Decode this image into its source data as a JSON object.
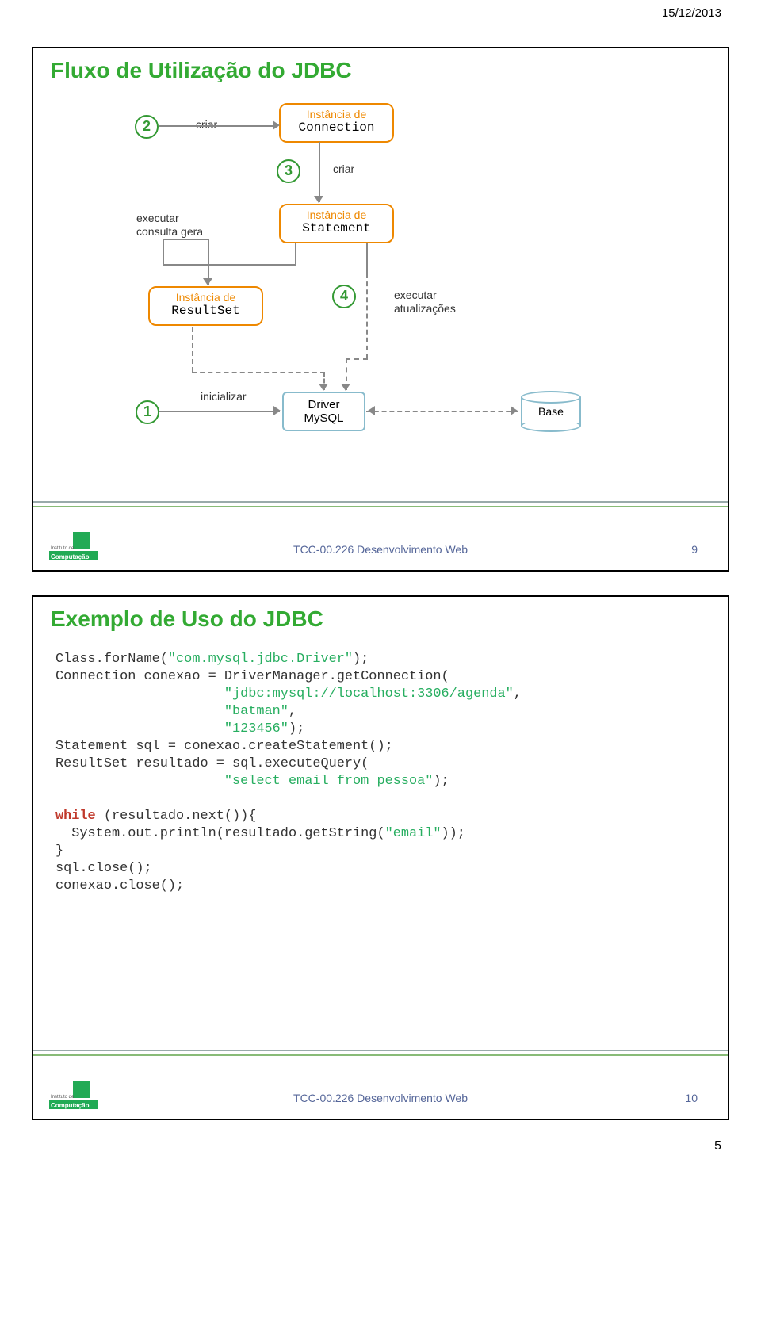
{
  "date": "15/12/2013",
  "slide1": {
    "title": "Fluxo de Utilização do JDBC",
    "labels": {
      "criar2": "criar",
      "criar3": "criar",
      "executar_consulta": "executar",
      "consulta_gera": "consulta gera",
      "executar_atualizacoes1": "executar",
      "executar_atualizacoes2": "atualizações",
      "inicializar": "inicializar"
    },
    "boxes": {
      "connection_lbl": "Instância de",
      "connection_name": "Connection",
      "statement_lbl": "Instância de",
      "statement_name": "Statement",
      "resultset_lbl": "Instância de",
      "resultset_name": "ResultSet",
      "driver_l1": "Driver",
      "driver_l2": "MySQL",
      "base": "Base"
    },
    "nums": {
      "n1": "1",
      "n2": "2",
      "n3": "3",
      "n4": "4"
    },
    "footer": {
      "text": "TCC-00.226 Desenvolvimento Web",
      "num": "9"
    }
  },
  "slide2": {
    "title": "Exemplo de Uso do JDBC",
    "code": {
      "l1a": "Class.forName(",
      "l1b": "\"com.mysql.jdbc.Driver\"",
      "l1c": ");",
      "l2": "Connection conexao = DriverManager.getConnection(",
      "l3": "\"jdbc:mysql://localhost:3306/agenda\"",
      "l3b": ", ",
      "l4": "\"batman\"",
      "l4b": ", ",
      "l5": "\"123456\"",
      "l5b": ");",
      "l6": "Statement sql = conexao.createStatement();",
      "l7": "ResultSet resultado = sql.executeQuery(",
      "l8": "\"select email from pessoa\"",
      "l8b": ");",
      "l9a": "while",
      "l9b": " (resultado.next()){",
      "l10a": "  System.out.println(resultado.getString(",
      "l10b": "\"email\"",
      "l10c": "));",
      "l11": "}",
      "l12": "sql.close();",
      "l13": "conexao.close();"
    },
    "footer": {
      "text": "TCC-00.226 Desenvolvimento Web",
      "num": "10"
    }
  },
  "page_number": "5"
}
